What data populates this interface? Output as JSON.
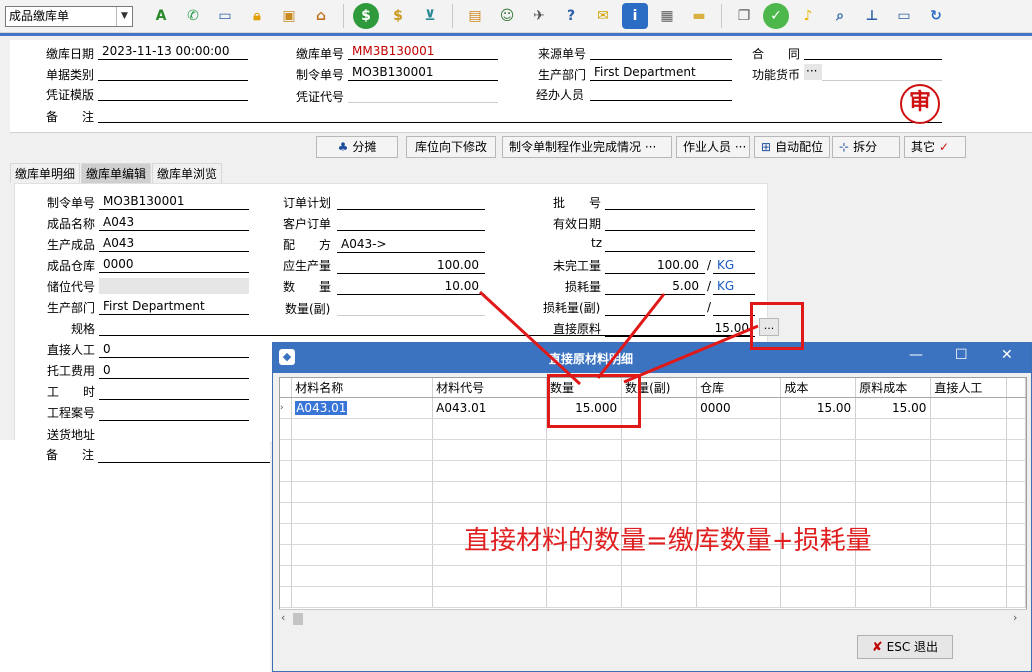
{
  "toolbar": {
    "doc_type": "成品缴库单",
    "icons": [
      "spell-check-icon",
      "phone-icon",
      "monitor-icon",
      "lock-icon",
      "briefcase-icon",
      "home-icon",
      "dollar-icon",
      "money-bag-icon",
      "cart-icon",
      "clipboard-icon",
      "users-icon",
      "satellite-icon",
      "help-doc-icon",
      "mail-icon",
      "info-icon",
      "calculator-icon",
      "folder-icon",
      "copy-doc-icon",
      "check-icon",
      "bell-icon",
      "search-icon",
      "org-chart-icon",
      "computer-icon",
      "refresh-icon"
    ]
  },
  "header": {
    "date_label": "缴库日期",
    "date_value": "2023-11-13 00:00:00",
    "doc_no_label": "缴库单号",
    "doc_no_value": "MM3B130001",
    "source_label": "来源单号",
    "source_value": "",
    "contract_label": "合　　同",
    "contract_value": "",
    "category_label": "单据类别",
    "category_value": "",
    "order_label": "制令单号",
    "order_value": "MO3B130001",
    "dept_label": "生产部门",
    "dept_value": "First Department",
    "currency_label": "功能货币",
    "currency_value": "···",
    "template_label": "凭证模版",
    "template_value": "",
    "voucher_label": "凭证代号",
    "voucher_value": "",
    "handler_label": "经办人员",
    "handler_value": "",
    "remark_label": "备　　注",
    "remark_value": "",
    "stamp": "审"
  },
  "buttons": {
    "split": "分摊",
    "modify": "库位向下修改",
    "progress": "制令单制程作业完成情况 ···",
    "worker": "作业人员 ···",
    "auto": "自动配位",
    "divide": "拆分",
    "other": "其它"
  },
  "tabs": [
    "缴库单明细",
    "缴库单编辑",
    "缴库单浏览"
  ],
  "detail": {
    "order_label": "制令单号",
    "order_value": "MO3B130001",
    "name_label": "成品名称",
    "name_value": "A043",
    "product_label": "生产成品",
    "product_value": "A043",
    "wh_label": "成品仓库",
    "wh_value": "0000",
    "loc_label": "储位代号",
    "loc_value": "",
    "dept_label": "生产部门",
    "dept_value": "First Department",
    "spec_label": "规格",
    "spec_value": "",
    "labor_label": "直接人工",
    "labor_value": "0",
    "outsource_label": "托工费用",
    "outsource_value": "0",
    "hours_label": "工　　时",
    "hours_value": "",
    "project_label": "工程案号",
    "project_value": "",
    "delivery_label": "送货地址",
    "delivery_value": "",
    "remark_label": "备　　注",
    "remark_value": "",
    "plan_label": "订单计划",
    "plan_value": "",
    "cust_label": "客户订单",
    "cust_value": "",
    "formula_label": "配　　方",
    "formula_value": "A043->",
    "should_label": "应生产量",
    "should_value": "100.00",
    "qty_label": "数　　量",
    "qty_value": "10.00",
    "qty2_label": "数量(副)",
    "qty2_value": "",
    "batch_label": "批　　号",
    "batch_value": "",
    "expire_label": "有效日期",
    "expire_value": "",
    "tz_label": "tz",
    "tz_value": "",
    "unfinished_label": "未完工量",
    "unfinished_value": "100.00",
    "unfinished_unit": "KG",
    "loss_label": "损耗量",
    "loss_value": "5.00",
    "loss_unit": "KG",
    "loss2_label": "损耗量(副)",
    "loss2_value": "",
    "material_label": "直接原料",
    "material_value": "15.00",
    "ellipsis": "..."
  },
  "dialog": {
    "title": "直接原材料明细",
    "columns": [
      "材料名称",
      "材料代号",
      "数量",
      "数量(副)",
      "仓库",
      "成本",
      "原料成本",
      "直接人工"
    ],
    "rows": [
      [
        "A043.01",
        "A043.01",
        "15.000",
        "",
        "0000",
        "15.00",
        "15.00",
        ""
      ]
    ],
    "annotation": "直接材料的数量=缴库数量+损耗量",
    "esc_label": "ESC 退出"
  },
  "colors": {
    "accent": "#3c73c1",
    "highlight": "#e01818"
  }
}
